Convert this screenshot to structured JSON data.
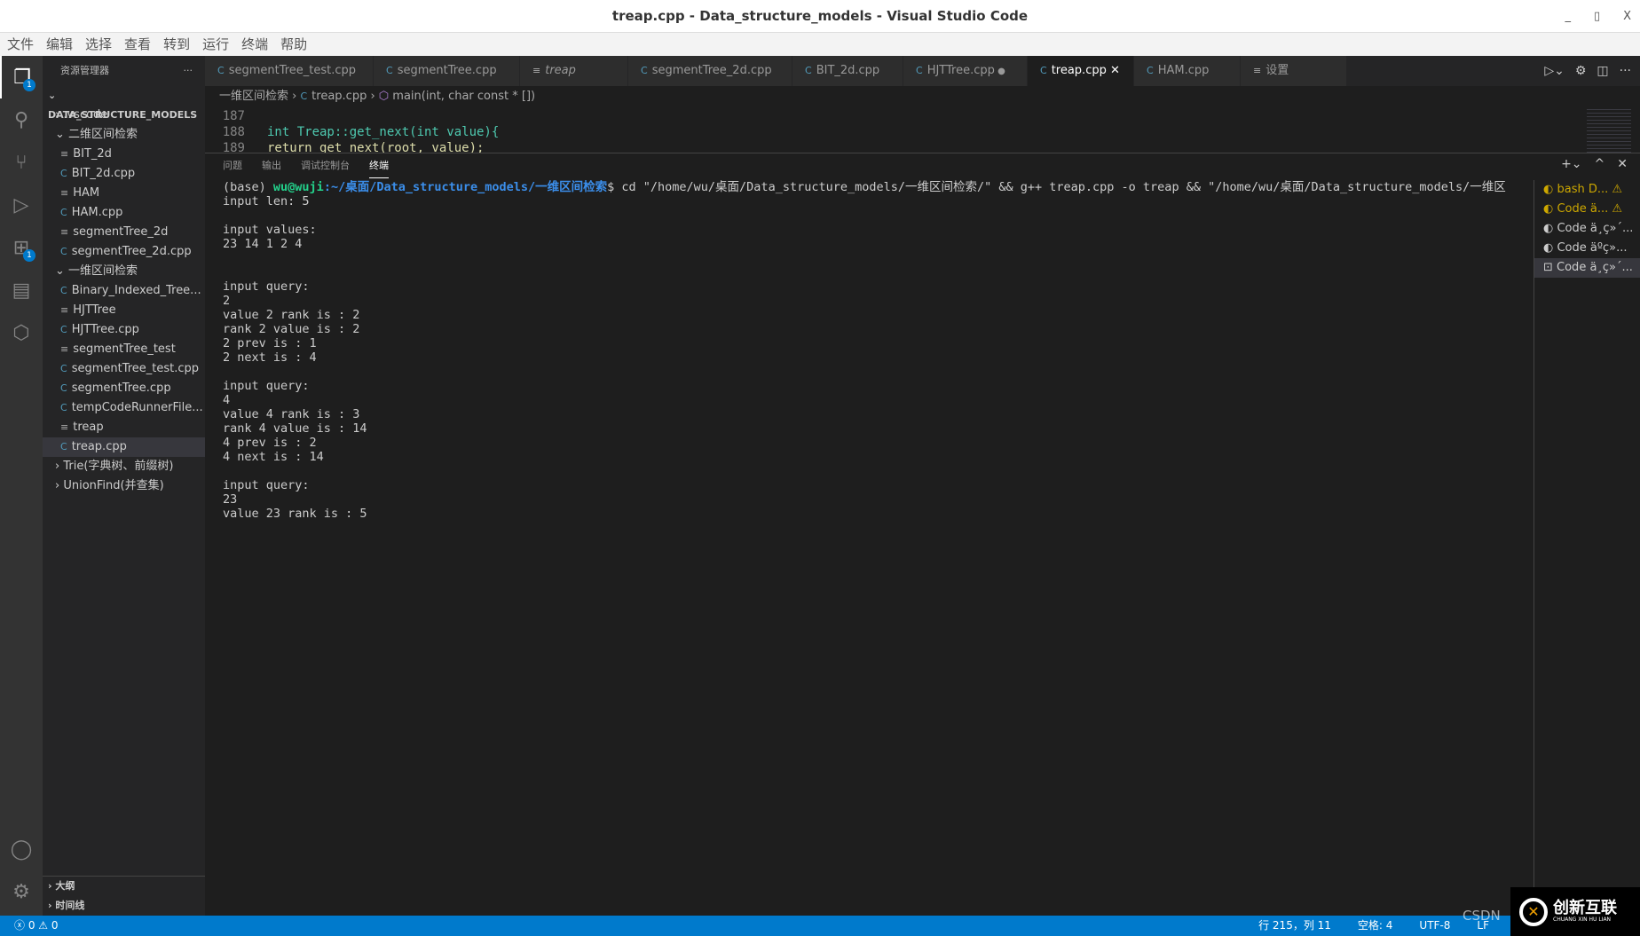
{
  "window": {
    "title": "treap.cpp - Data_structure_models - Visual Studio Code",
    "minimize": "_",
    "maximize": "▯",
    "close": "X"
  },
  "menu": [
    "文件",
    "编辑",
    "选择",
    "查看",
    "转到",
    "运行",
    "终端",
    "帮助"
  ],
  "activity": {
    "explorer_badge": "1",
    "extensions_badge": "1"
  },
  "sidebar": {
    "title": "资源管理器",
    "more": "···",
    "root": "DATA_STRUCTURE_MODELS",
    "items": [
      {
        "label": ".vscode",
        "type": "folder",
        "open": false,
        "depth": 1
      },
      {
        "label": "二维区间检索",
        "type": "folder",
        "open": true,
        "depth": 1
      },
      {
        "label": "BIT_2d",
        "type": "file",
        "depth": 2
      },
      {
        "label": "BIT_2d.cpp",
        "type": "cpp",
        "depth": 2
      },
      {
        "label": "HAM",
        "type": "file",
        "depth": 2
      },
      {
        "label": "HAM.cpp",
        "type": "cpp",
        "depth": 2
      },
      {
        "label": "segmentTree_2d",
        "type": "file",
        "depth": 2
      },
      {
        "label": "segmentTree_2d.cpp",
        "type": "cpp",
        "depth": 2
      },
      {
        "label": "一维区间检索",
        "type": "folder",
        "open": true,
        "depth": 1
      },
      {
        "label": "Binary_Indexed_Tree...",
        "type": "cpp",
        "depth": 2
      },
      {
        "label": "HJTTree",
        "type": "file",
        "depth": 2
      },
      {
        "label": "HJTTree.cpp",
        "type": "cpp",
        "depth": 2
      },
      {
        "label": "segmentTree_test",
        "type": "file",
        "depth": 2
      },
      {
        "label": "segmentTree_test.cpp",
        "type": "cpp",
        "depth": 2
      },
      {
        "label": "segmentTree.cpp",
        "type": "cpp",
        "depth": 2
      },
      {
        "label": "tempCodeRunnerFile...",
        "type": "cpp",
        "depth": 2
      },
      {
        "label": "treap",
        "type": "file",
        "depth": 2
      },
      {
        "label": "treap.cpp",
        "type": "cpp",
        "depth": 2,
        "selected": true
      },
      {
        "label": "Trie(字典树、前缀树)",
        "type": "folder",
        "open": false,
        "depth": 1
      },
      {
        "label": "UnionFind(并查集)",
        "type": "folder",
        "open": false,
        "depth": 1
      }
    ],
    "outline": "大纲",
    "timeline": "时间线"
  },
  "tabs": [
    {
      "label": "segmentTree_test.cpp",
      "icon": "cpp"
    },
    {
      "label": "segmentTree.cpp",
      "icon": "cpp"
    },
    {
      "label": "treap",
      "icon": "file",
      "italic": true
    },
    {
      "label": "segmentTree_2d.cpp",
      "icon": "cpp"
    },
    {
      "label": "BIT_2d.cpp",
      "icon": "cpp"
    },
    {
      "label": "HJTTree.cpp",
      "icon": "cpp",
      "dirty": true
    },
    {
      "label": "treap.cpp",
      "icon": "cpp",
      "active": true
    },
    {
      "label": "HAM.cpp",
      "icon": "cpp"
    },
    {
      "label": "设置",
      "icon": "settings"
    }
  ],
  "breadcrumb": {
    "folder": "一维区间检索",
    "file": "treap.cpp",
    "symbol": "main(int, char const * [])"
  },
  "editor": {
    "lines": [
      {
        "n": "187",
        "code": ""
      },
      {
        "n": "188",
        "code": "int Treap::get_next(int value){"
      },
      {
        "n": "189",
        "code": "    return get_next(root, value);"
      }
    ]
  },
  "panel": {
    "tabs": [
      "问题",
      "输出",
      "调试控制台",
      "终端"
    ],
    "active": "终端"
  },
  "terminal": {
    "prompt_env": "(base) ",
    "prompt_user": "wu@wuji",
    "prompt_path": ":~/桌面/Data_structure_models/一维区间检索",
    "prompt_cmd": "$ cd \"/home/wu/桌面/Data_structure_models/一维区间检索/\" && g++ treap.cpp -o treap && \"/home/wu/桌面/Data_structure_models/一维区",
    "output": "input len: 5\n\ninput values:\n23 14 1 2 4\n\n\ninput query:\n2\nvalue 2 rank is : 2\nrank 2 value is : 2\n2 prev is : 1\n2 next is : 4\n\ninput query:\n4\nvalue 4 rank is : 3\nrank 4 value is : 14\n4 prev is : 2\n4 next is : 14\n\ninput query:\n23\nvalue 23 rank is : 5",
    "instances": [
      {
        "label": "bash D...",
        "warn": true
      },
      {
        "label": "Code ä...",
        "warn": true
      },
      {
        "label": "Code ä¸ç»´..."
      },
      {
        "label": "Code äºç»..."
      },
      {
        "label": "Code ä¸ç»´...",
        "selected": true
      }
    ]
  },
  "status": {
    "errors": "0",
    "warnings": "0",
    "position": "行 215，列 11",
    "spaces": "空格: 4",
    "encoding": "UTF-8",
    "eol": "LF"
  },
  "watermark": "CSDN",
  "logo": {
    "name": "创新互联",
    "sub": "CHUANG XIN HU LIAN"
  }
}
